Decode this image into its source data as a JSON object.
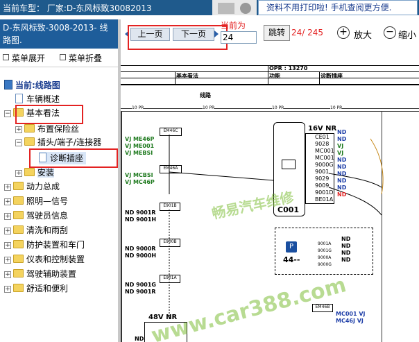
{
  "header": {
    "vehicle_label": "当前车型：  厂家:D-东风标致30082013",
    "ad_text": "资料不用打印啦! 手机查阅更方便."
  },
  "left_panel": {
    "model_title": "D-东风标致-3008-2013- 线路图.",
    "expand_label": "菜单展开",
    "collapse_label": "菜单折叠",
    "tree": {
      "current": "当前:线路图",
      "items": [
        {
          "label": "车辆概述"
        },
        {
          "label": "基本看法"
        },
        {
          "label": "布置保险丝"
        },
        {
          "label": "插头/端子/连接器"
        },
        {
          "label": "诊断插座"
        },
        {
          "label": "安装"
        },
        {
          "label": "动力总成"
        },
        {
          "label": "照明—信号"
        },
        {
          "label": "驾驶员信息"
        },
        {
          "label": "清洗和雨刮"
        },
        {
          "label": "防护装置和车门"
        },
        {
          "label": "仪表和控制装置"
        },
        {
          "label": "驾驶辅助装置"
        },
        {
          "label": "舒适和便利"
        }
      ]
    }
  },
  "toolbar": {
    "prev_label": "上一页",
    "next_label": "下一页",
    "current_label": "当前为",
    "page_value": "24",
    "jump_label": "跳转",
    "page_count": "24/ 245",
    "zoom_in_label": "放大",
    "zoom_out_label": "缩小"
  },
  "diagram": {
    "opr": "OPR : 13270",
    "col1": "基本看法",
    "col2": "功能",
    "col3": "诊断插座",
    "section": "线路",
    "tag": "10 PR",
    "connector_title": "16V NR",
    "connector_id": "C001",
    "pins": [
      "CE01",
      "9028",
      "MC001",
      "MC001",
      "9000G",
      "9001",
      "9029",
      "9009",
      "9001D",
      "BE01A"
    ],
    "pin_states": [
      "ND",
      "ND",
      "VJ",
      "VJ",
      "ND",
      "ND",
      "ND",
      "ND",
      "ND",
      "ND"
    ],
    "left_groups": [
      {
        "box": "EM46C",
        "lines": [
          "VJ ME46P",
          "VJ ME001",
          "VJ MEBSI"
        ]
      },
      {
        "box": "EM46A",
        "lines": [
          "VJ MCBSI",
          "VJ MC46P"
        ]
      },
      {
        "box": "E901B",
        "lines": [
          "ND 9001R",
          "ND 9001H"
        ]
      },
      {
        "box": "E900B",
        "lines": [
          "ND 9000R",
          "ND 9000H"
        ]
      },
      {
        "box": "E901A",
        "lines": [
          "ND 9001G",
          "ND 9001R"
        ]
      }
    ],
    "bottom_label": "48V NR",
    "bottom_nd": "ND",
    "module_id": "44--",
    "module_pins": [
      "9001A",
      "9001G",
      "9000A",
      "9000G"
    ],
    "module_states": [
      "ND",
      "ND",
      "ND",
      "ND"
    ],
    "em46b": "EM46B",
    "em46b_lines": [
      "MC001 VJ",
      "MC46J VJ"
    ],
    "watermark1": "畅易汽车维修",
    "watermark2": "www.car388.com"
  },
  "colors": {
    "header_bg": "#1f5a8c",
    "panel_title_bg": "#1e5d9a",
    "highlight_red": "#e32222",
    "watermark_green": "#7fbf3a"
  }
}
